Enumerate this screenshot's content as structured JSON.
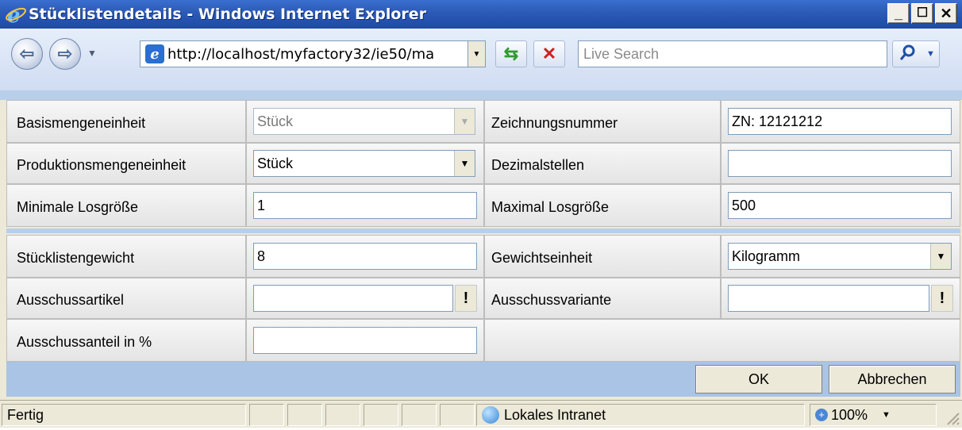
{
  "window": {
    "title": "Stücklistendetails - Windows Internet Explorer",
    "min_glyph": "_",
    "max_glyph": "☐",
    "close_glyph": "✕"
  },
  "nav": {
    "back_glyph": "⇦",
    "forward_glyph": "⇨",
    "address": "http://localhost/myfactory32/ie50/ma",
    "search_placeholder": "Live Search"
  },
  "form": {
    "section1": [
      {
        "left_label": "Basismengeneinheit",
        "left_value": "Stück",
        "left_type": "select-disabled",
        "right_label": "Zeichnungsnummer",
        "right_value": "ZN: 12121212",
        "right_type": "text"
      },
      {
        "left_label": "Produktionsmengeneinheit",
        "left_value": "Stück",
        "left_type": "select",
        "right_label": "Dezimalstellen",
        "right_value": "",
        "right_type": "text"
      },
      {
        "left_label": "Minimale Losgröße",
        "left_value": "1",
        "left_type": "text",
        "right_label": "Maximal Losgröße",
        "right_value": "500",
        "right_type": "text"
      }
    ],
    "section2": [
      {
        "left_label": "Stücklistengewicht",
        "left_value": "8",
        "left_type": "text",
        "right_label": "Gewichtseinheit",
        "right_value": "Kilogramm",
        "right_type": "select"
      },
      {
        "left_label": "Ausschussartikel",
        "left_value": "",
        "left_type": "lookup",
        "right_label": "Ausschussvariante",
        "right_value": "",
        "right_type": "lookup"
      },
      {
        "left_label": "Ausschussanteil in %",
        "left_value": "",
        "left_type": "text"
      }
    ],
    "lookup_glyph": "!",
    "dropdown_glyph": "▼"
  },
  "buttons": {
    "ok": "OK",
    "cancel": "Abbrechen"
  },
  "status": {
    "text": "Fertig",
    "zone": "Lokales Intranet",
    "zoom": "100%"
  }
}
